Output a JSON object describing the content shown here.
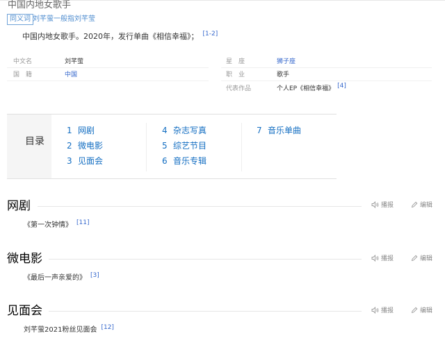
{
  "page": {
    "subtitle": "中国内地女歌手",
    "synonym_tag": "同义词",
    "synonym_text": "刘芊萤一般指刘芊莹",
    "summary": "中国内地女歌手。2020年，发行单曲《相信幸福》；",
    "summary_ref": "[1-2]"
  },
  "basic_info": {
    "left": [
      {
        "label": "中文名",
        "value": "刘芊萤"
      },
      {
        "label": "国　籍",
        "value": "中国"
      }
    ],
    "right": [
      {
        "label": "星　座",
        "value": "狮子座"
      },
      {
        "label": "职　业",
        "value": "歌手"
      },
      {
        "label": "代表作品",
        "value": "个人EP《相信幸福》",
        "ref": "[4]"
      }
    ]
  },
  "catalog": {
    "title": "目录",
    "items": [
      {
        "num": "1",
        "label": "网剧"
      },
      {
        "num": "2",
        "label": "微电影"
      },
      {
        "num": "3",
        "label": "见面会"
      },
      {
        "num": "4",
        "label": "杂志写真"
      },
      {
        "num": "5",
        "label": "综艺节目"
      },
      {
        "num": "6",
        "label": "音乐专辑"
      },
      {
        "num": "7",
        "label": "音乐单曲"
      }
    ]
  },
  "tools": {
    "report": "播报",
    "edit": "编辑"
  },
  "sections": [
    {
      "title": "网剧",
      "text": "《第一次钟情》",
      "ref": "[11]"
    },
    {
      "title": "微电影",
      "text": "《最后一声亲爱的》",
      "ref": "[3]"
    },
    {
      "title": "见面会",
      "text": "刘芊萤2021粉丝见面会",
      "ref": "[12]"
    }
  ],
  "colors": {
    "link": "#136ec2",
    "accent": "#4e8ccf"
  }
}
